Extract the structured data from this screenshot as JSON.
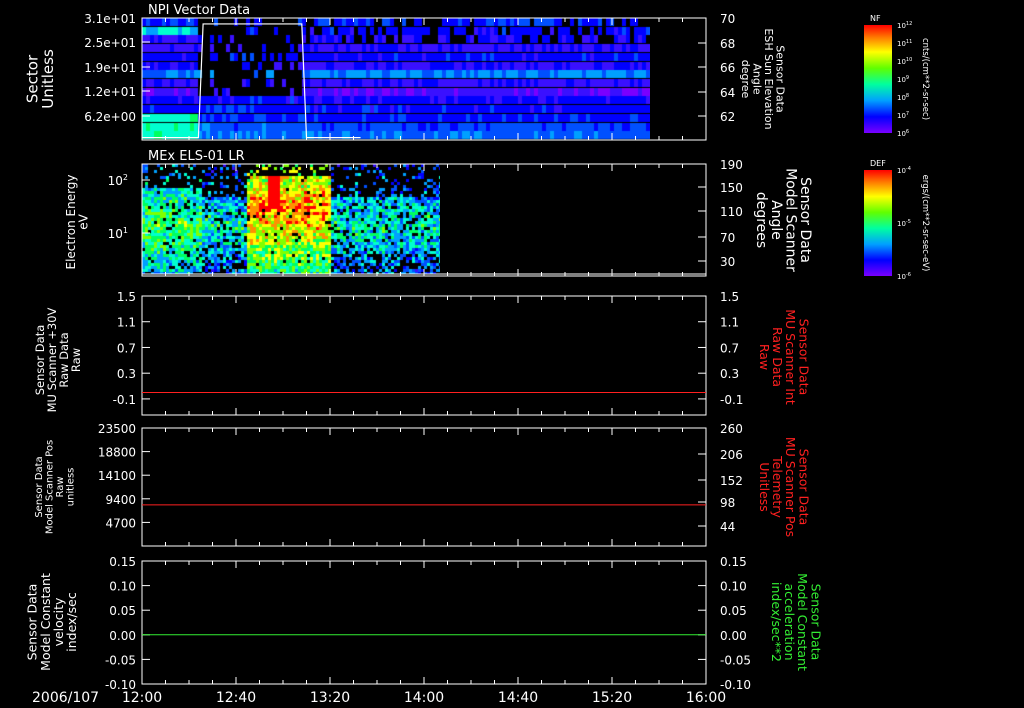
{
  "colors": {
    "white": "#ffffff",
    "red": "#ff2020",
    "green": "#33ee33",
    "bg": "#000000"
  },
  "time_axis": {
    "ticks": [
      "12:00",
      "12:40",
      "13:20",
      "14:00",
      "14:40",
      "15:20",
      "16:00"
    ],
    "date": "2006/107"
  },
  "chart_data": [
    {
      "type": "heatmap",
      "title": "NPI Vector Data",
      "ylabel": [
        "Sector",
        "Unitless"
      ],
      "y_ticks": [
        "3.1e+01",
        "2.5e+01",
        "1.9e+01",
        "1.2e+01",
        "6.2e+00"
      ],
      "y2label": [
        "Sensor Data",
        "ESH Sun Elevation",
        "Angle",
        "degree"
      ],
      "y2_ticks": [
        "70",
        "68",
        "66",
        "64",
        "62"
      ],
      "overlay_line": {
        "x": [
          "12:00",
          "12:24",
          "12:26",
          "13:08",
          "13:10",
          "13:33"
        ],
        "y": [
          60.2,
          60.2,
          69.8,
          69.8,
          60.2,
          60.2
        ]
      },
      "colorbar": {
        "label": "NF",
        "units": "cnts/(cm**2-sr-sec)",
        "ticks": [
          "10^12",
          "10^11",
          "10^10",
          "10^9",
          "10^8",
          "10^7",
          "10^6"
        ]
      },
      "data_end": "15:36"
    },
    {
      "type": "heatmap",
      "title": "MEx ELS-01 LR",
      "ylabel": [
        "Electron Energy",
        "eV"
      ],
      "y_ticks": [
        "10^2",
        "10^1"
      ],
      "y2label": [
        "Sensor Data",
        "Model Scanner",
        "Angle",
        "degrees"
      ],
      "y2_ticks": [
        "190",
        "150",
        "110",
        "70",
        "30"
      ],
      "colorbar": {
        "label": "DEF",
        "units": "ergs/(cm**2-sr-sec-eV)",
        "ticks": [
          "10^-4",
          "10^-5",
          "10^-6"
        ]
      },
      "data_end": "14:07"
    },
    {
      "type": "line",
      "ylabel": [
        "Sensor Data",
        "MU Scanner +30V",
        "Raw Data",
        "Raw"
      ],
      "y_ticks": [
        "1.5",
        "1.1",
        "0.7",
        "0.3",
        "-0.1"
      ],
      "ylim": [
        -0.35,
        1.5
      ],
      "y2label": [
        "Sensor Data",
        "MU Scanner Int",
        "Raw Data",
        "Raw"
      ],
      "y2_ticks": [
        "1.5",
        "1.1",
        "0.7",
        "0.3",
        "-0.1"
      ],
      "series": [
        {
          "x": [
            "12:00",
            "16:00"
          ],
          "values": [
            0.0,
            0.0
          ],
          "color": "#ff2020"
        }
      ]
    },
    {
      "type": "line",
      "ylabel": [
        "Sensor Data",
        "Model Scanner Pos",
        "Raw",
        "unitless"
      ],
      "y_ticks": [
        "23500",
        "18800",
        "14100",
        "9400",
        "4700"
      ],
      "ylim": [
        0,
        23500
      ],
      "y2label": [
        "Sensor Data",
        "MU Scanner Pos",
        "Telemetry",
        "Unitless"
      ],
      "y2_ticks": [
        "260",
        "206",
        "152",
        "98",
        "44"
      ],
      "series": [
        {
          "x": [
            "12:00",
            "16:00"
          ],
          "values": [
            8200,
            8200
          ],
          "color": "#ff2020"
        }
      ]
    },
    {
      "type": "line",
      "ylabel": [
        "Sensor Data",
        "Model Constant",
        "velocity",
        "index/sec"
      ],
      "y_ticks": [
        "0.15",
        "0.10",
        "0.05",
        "0.00",
        "-0.05",
        "-0.10"
      ],
      "ylim": [
        -0.1,
        0.15
      ],
      "y2label": [
        "Sensor Data",
        "Model Constant",
        "acceleration",
        "index/sec**2"
      ],
      "y2_ticks": [
        "0.15",
        "0.10",
        "0.05",
        "0.00",
        "-0.05",
        "-0.10"
      ],
      "series": [
        {
          "x": [
            "12:00",
            "16:00"
          ],
          "values": [
            0.0,
            0.0
          ],
          "color": "#33ee33"
        }
      ]
    }
  ]
}
